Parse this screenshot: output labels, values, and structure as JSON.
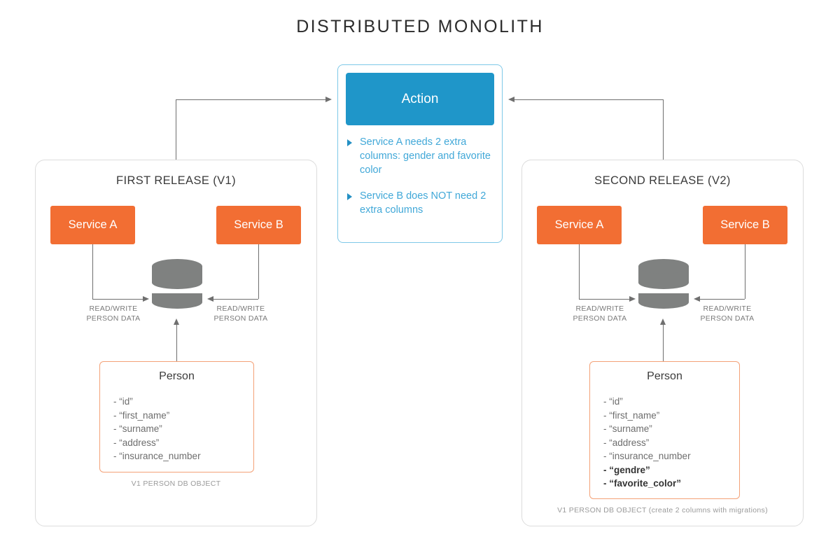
{
  "title": "DISTRIBUTED MONOLITH",
  "colors": {
    "service_orange": "#f26e33",
    "action_blue": "#1f96c9",
    "action_text_blue": "#41a8d8",
    "bullet_blue": "#2490c4",
    "db_gray": "#7f8180",
    "panel_border": "#dcdcdc",
    "person_border": "#f4a177",
    "arrow_gray": "#6f6f6f"
  },
  "action": {
    "header_label": "Action",
    "items": [
      {
        "text": "Service A needs 2 extra columns: gender and favorite color"
      },
      {
        "text": "Service B does NOT need 2 extra columns"
      }
    ]
  },
  "releases": [
    {
      "id": "first-release",
      "title": "FIRST RELEASE (V1)",
      "services": [
        {
          "label": "Service A"
        },
        {
          "label": "Service B"
        }
      ],
      "db_labels": [
        {
          "text": "READ/WRITE\nPERSON DATA"
        },
        {
          "text": "READ/WRITE\nPERSON DATA"
        }
      ],
      "entity": {
        "title": "Person",
        "fields": [
          {
            "text": "- “id”",
            "emphasis": false
          },
          {
            "text": "- “first_name”",
            "emphasis": false
          },
          {
            "text": "- “surname”",
            "emphasis": false
          },
          {
            "text": "- “address”",
            "emphasis": false
          },
          {
            "text": "- “insurance_number",
            "emphasis": false
          }
        ],
        "caption": "V1 PERSON DB OBJECT"
      }
    },
    {
      "id": "second-release",
      "title": "SECOND RELEASE (V2)",
      "services": [
        {
          "label": "Service A"
        },
        {
          "label": "Service B"
        }
      ],
      "db_labels": [
        {
          "text": "READ/WRITE\nPERSON DATA"
        },
        {
          "text": "READ/WRITE\nPERSON DATA"
        }
      ],
      "entity": {
        "title": "Person",
        "fields": [
          {
            "text": "- “id”",
            "emphasis": false
          },
          {
            "text": "- “first_name”",
            "emphasis": false
          },
          {
            "text": "- “surname”",
            "emphasis": false
          },
          {
            "text": "- “address”",
            "emphasis": false
          },
          {
            "text": "- “insurance_number",
            "emphasis": false
          },
          {
            "text": "- “gendre”",
            "emphasis": true
          },
          {
            "text": "- “favorite_color”",
            "emphasis": true
          }
        ],
        "caption": "V1 PERSON DB OBJECT (create 2 columns with migrations)"
      }
    }
  ]
}
